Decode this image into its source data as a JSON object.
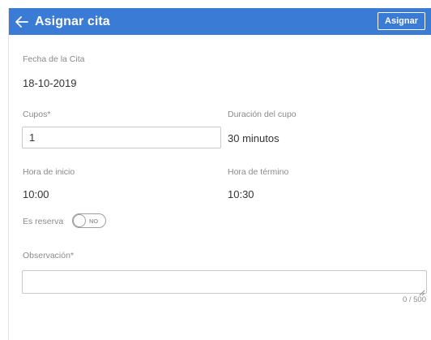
{
  "header": {
    "title": "Asignar cita",
    "action_label": "Asignar",
    "back_icon": "arrow-left-icon",
    "background_color": "#3a7bd5"
  },
  "form": {
    "fecha": {
      "label": "Fecha de la Cita",
      "value": "18-10-2019"
    },
    "cupos": {
      "label": "Cupos*",
      "value": "1"
    },
    "duracion": {
      "label": "Duración del cupo",
      "value": "30 minutos"
    },
    "hora_inicio": {
      "label": "Hora de inicio",
      "value": "10:00"
    },
    "hora_termino": {
      "label": "Hora de término",
      "value": "10:30"
    },
    "reserva": {
      "label": "Es reserva",
      "state": "NO"
    },
    "observacion": {
      "label": "Observación*",
      "value": "",
      "counter": "0 / 500"
    }
  }
}
